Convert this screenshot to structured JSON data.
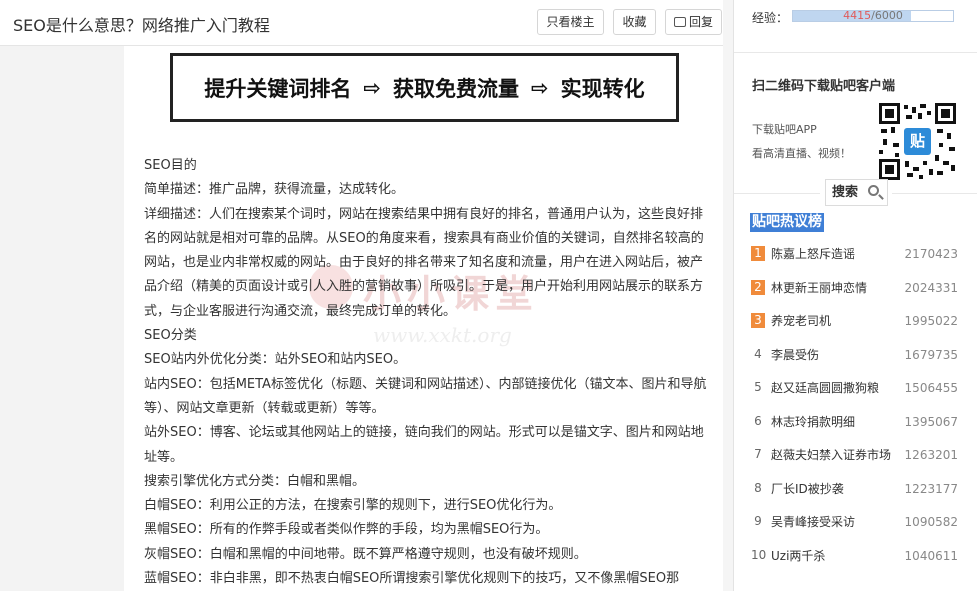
{
  "header": {
    "title": "SEO是什么意思？网络推广入门教程",
    "only_author": "只看楼主",
    "favorite": "收藏",
    "reply": "回复"
  },
  "banner": {
    "step1": "提升关键词排名",
    "step2": "获取免费流量",
    "step3": "实现转化",
    "arrow": "⇨"
  },
  "watermark": {
    "text": "小小课堂",
    "url": "www.xxkt.org"
  },
  "content": {
    "paragraphs": [
      "SEO目的",
      "简单描述：推广品牌，获得流量，达成转化。",
      "详细描述：人们在搜索某个词时，网站在搜索结果中拥有良好的排名，普通用户认为，这些良好排名的网站就是相对可靠的品牌。从SEO的角度来看，搜索具有商业价值的关键词，自然排名较高的网站，也是业内非常权威的网站。由于良好的排名带来了知名度和流量，用户在进入网站后，被产品介绍（精美的页面设计或引人入胜的营销故事）所吸引。于是，用户开始利用网站展示的联系方式，与企业客服进行沟通交流，最终完成订单的转化。",
      "SEO分类",
      "SEO站内外优化分类：站外SEO和站内SEO。",
      "站内SEO：包括META标签优化（标题、关键词和网站描述）、内部链接优化（锚文本、图片和导航等）、网站文章更新（转载或更新）等等。",
      "站外SEO：博客、论坛或其他网站上的链接，链向我们的网站。形式可以是锚文字、图片和网站地址等。",
      "搜索引擎优化方式分类：白帽和黑帽。",
      "白帽SEO：利用公正的方法，在搜索引擎的规则下，进行SEO优化行为。",
      "黑帽SEO：所有的作弊手段或者类似作弊的手段，均为黑帽SEO行为。",
      "灰帽SEO：白帽和黑帽的中间地带。既不算严格遵守规则，也没有破坏规则。",
      "蓝帽SEO：非白非黑，即不热衷白帽SEO所谓搜索引擎优化规则下的技巧，又不像黑帽SEO那"
    ]
  },
  "sidebar": {
    "exp_label": "经验：",
    "exp_current": "4415",
    "exp_total": "/6000",
    "exp_fraction": 0.736,
    "qr_title": "扫二维码下载贴吧客户端",
    "qr_line1": "下载贴吧APP",
    "qr_line2": "看高清直播、视频！",
    "qr_badge": "贴",
    "search_label": "搜索",
    "hot_title": "贴吧热议榜",
    "hot_items": [
      {
        "rank": "1",
        "topic": "陈嘉上怒斥造谣",
        "count": "2170423"
      },
      {
        "rank": "2",
        "topic": "林更新王丽坤恋情",
        "count": "2024331"
      },
      {
        "rank": "3",
        "topic": "养宠老司机",
        "count": "1995022"
      },
      {
        "rank": "4",
        "topic": "李晨受伤",
        "count": "1679735"
      },
      {
        "rank": "5",
        "topic": "赵又廷高圆圆撒狗粮",
        "count": "1506455"
      },
      {
        "rank": "6",
        "topic": "林志玲捐款明细",
        "count": "1395067"
      },
      {
        "rank": "7",
        "topic": "赵薇夫妇禁入证券市场",
        "count": "1263201"
      },
      {
        "rank": "8",
        "topic": "厂长ID被抄袭",
        "count": "1223177"
      },
      {
        "rank": "9",
        "topic": "吴青峰接受采访",
        "count": "1090582"
      },
      {
        "rank": "10",
        "topic": "Uzi两千杀",
        "count": "1040611"
      }
    ]
  }
}
